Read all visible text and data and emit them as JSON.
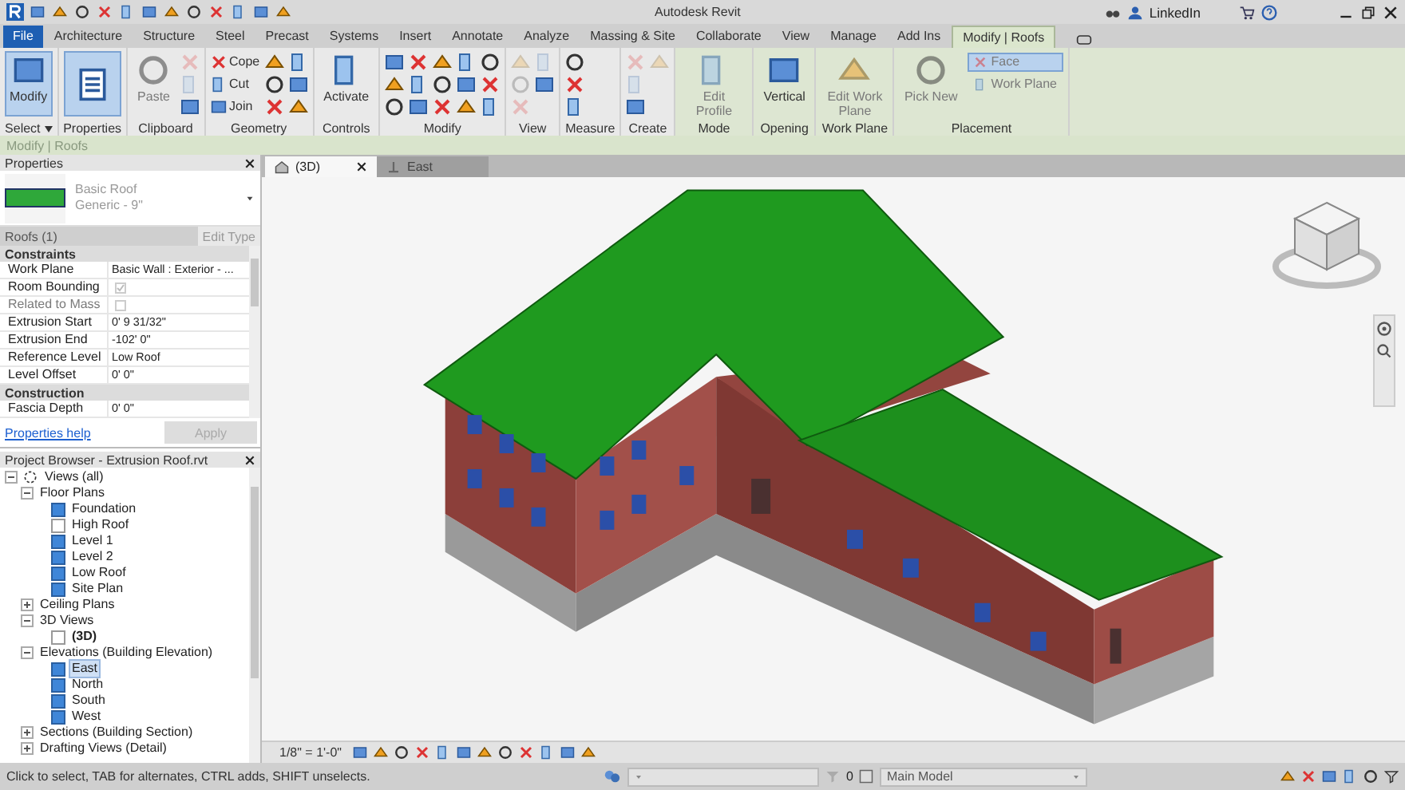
{
  "title_bar": {
    "title": "Autodesk Revit",
    "user": "LinkedIn"
  },
  "ribbon_tabs": [
    {
      "label": "File",
      "kind": "file",
      "selected": false
    },
    {
      "label": "Architecture",
      "kind": "tab",
      "selected": false
    },
    {
      "label": "Structure",
      "kind": "tab",
      "selected": false
    },
    {
      "label": "Steel",
      "kind": "tab",
      "selected": false
    },
    {
      "label": "Precast",
      "kind": "tab",
      "selected": false
    },
    {
      "label": "Systems",
      "kind": "tab",
      "selected": false
    },
    {
      "label": "Insert",
      "kind": "tab",
      "selected": false
    },
    {
      "label": "Annotate",
      "kind": "tab",
      "selected": false
    },
    {
      "label": "Analyze",
      "kind": "tab",
      "selected": false
    },
    {
      "label": "Massing & Site",
      "kind": "tab",
      "selected": false
    },
    {
      "label": "Collaborate",
      "kind": "tab",
      "selected": false
    },
    {
      "label": "View",
      "kind": "tab",
      "selected": false
    },
    {
      "label": "Manage",
      "kind": "tab",
      "selected": false
    },
    {
      "label": "Add Ins",
      "kind": "tab",
      "selected": false
    },
    {
      "label": "Modify | Roofs",
      "kind": "contextual",
      "selected": true
    }
  ],
  "ribbon_panels": [
    {
      "label": "Select",
      "dropdown": true,
      "contextual": false,
      "tools": [
        {
          "kind": "large",
          "label": "Modify",
          "selected": true,
          "disabled": false
        }
      ]
    },
    {
      "label": "Properties",
      "dropdown": false,
      "contextual": false,
      "tools": [
        {
          "kind": "large-icon",
          "selected": true,
          "disabled": false
        }
      ]
    },
    {
      "label": "Clipboard",
      "dropdown": false,
      "contextual": false,
      "tools": [
        {
          "kind": "large",
          "label": "Paste",
          "selected": false,
          "disabled": true
        },
        {
          "kind": "icon",
          "selected": false,
          "disabled": true
        },
        {
          "kind": "icon",
          "selected": false,
          "disabled": true
        },
        {
          "kind": "icon",
          "selected": false,
          "disabled": false
        }
      ]
    },
    {
      "label": "Geometry",
      "dropdown": false,
      "contextual": false,
      "tools": [
        {
          "kind": "small",
          "label": "Cope",
          "selected": false,
          "disabled": false
        },
        {
          "kind": "small",
          "label": "Cut",
          "selected": false,
          "disabled": false
        },
        {
          "kind": "small",
          "label": "Join",
          "selected": false,
          "disabled": false
        },
        {
          "kind": "icon",
          "selected": false,
          "disabled": false
        },
        {
          "kind": "icon",
          "selected": false,
          "disabled": false
        },
        {
          "kind": "icon",
          "selected": false,
          "disabled": false
        },
        {
          "kind": "icon",
          "selected": false,
          "disabled": false
        },
        {
          "kind": "icon",
          "selected": false,
          "disabled": false
        },
        {
          "kind": "icon",
          "selected": false,
          "disabled": false
        }
      ]
    },
    {
      "label": "Controls",
      "dropdown": false,
      "contextual": false,
      "tools": [
        {
          "kind": "large",
          "label": "Activate",
          "selected": false,
          "disabled": false
        }
      ]
    },
    {
      "label": "Modify",
      "dropdown": false,
      "contextual": false,
      "tools": [
        {
          "kind": "icon",
          "selected": false,
          "disabled": false
        },
        {
          "kind": "icon",
          "selected": false,
          "disabled": false
        },
        {
          "kind": "icon",
          "selected": false,
          "disabled": false
        },
        {
          "kind": "icon",
          "selected": false,
          "disabled": false
        },
        {
          "kind": "icon",
          "selected": false,
          "disabled": false
        },
        {
          "kind": "icon",
          "selected": false,
          "disabled": false
        },
        {
          "kind": "icon",
          "selected": false,
          "disabled": false
        },
        {
          "kind": "icon",
          "selected": false,
          "disabled": false
        },
        {
          "kind": "icon",
          "selected": false,
          "disabled": false
        },
        {
          "kind": "icon",
          "selected": false,
          "disabled": false
        },
        {
          "kind": "icon",
          "selected": false,
          "disabled": false
        },
        {
          "kind": "icon",
          "selected": false,
          "disabled": false
        },
        {
          "kind": "icon",
          "selected": false,
          "disabled": false
        },
        {
          "kind": "icon",
          "selected": false,
          "disabled": false
        },
        {
          "kind": "icon",
          "selected": false,
          "disabled": false
        }
      ]
    },
    {
      "label": "View",
      "dropdown": false,
      "contextual": false,
      "tools": [
        {
          "kind": "icon",
          "selected": false,
          "disabled": true
        },
        {
          "kind": "icon",
          "selected": false,
          "disabled": true
        },
        {
          "kind": "icon",
          "selected": false,
          "disabled": true
        },
        {
          "kind": "icon",
          "selected": false,
          "disabled": true
        },
        {
          "kind": "icon",
          "selected": false,
          "disabled": false
        }
      ]
    },
    {
      "label": "Measure",
      "dropdown": false,
      "contextual": false,
      "tools": [
        {
          "kind": "icon",
          "selected": false,
          "disabled": false
        },
        {
          "kind": "icon",
          "selected": false,
          "disabled": false
        },
        {
          "kind": "icon",
          "selected": false,
          "disabled": false
        }
      ]
    },
    {
      "label": "Create",
      "dropdown": false,
      "contextual": false,
      "tools": [
        {
          "kind": "icon",
          "selected": false,
          "disabled": true
        },
        {
          "kind": "icon",
          "selected": false,
          "disabled": true
        },
        {
          "kind": "icon",
          "selected": false,
          "disabled": false
        },
        {
          "kind": "icon",
          "selected": false,
          "disabled": true
        }
      ]
    },
    {
      "label": "Mode",
      "dropdown": false,
      "contextual": true,
      "tools": [
        {
          "kind": "large",
          "label": "Edit Profile",
          "selected": false,
          "disabled": true
        }
      ]
    },
    {
      "label": "Opening",
      "dropdown": false,
      "contextual": true,
      "tools": [
        {
          "kind": "large",
          "label": "Vertical",
          "selected": false,
          "disabled": false
        }
      ]
    },
    {
      "label": "Work Plane",
      "dropdown": false,
      "contextual": true,
      "tools": [
        {
          "kind": "large",
          "label": "Edit Work Plane",
          "selected": false,
          "disabled": true
        }
      ]
    },
    {
      "label": "Placement",
      "dropdown": false,
      "contextual": true,
      "tools": [
        {
          "kind": "large",
          "label": "Pick New",
          "selected": false,
          "disabled": true
        },
        {
          "kind": "toggle",
          "label": "Face",
          "selected": true,
          "disabled": true
        },
        {
          "kind": "toggle",
          "label": "Work Plane",
          "selected": false,
          "disabled": true
        }
      ]
    }
  ],
  "context_bar": {
    "label": "Modify | Roofs"
  },
  "properties": {
    "title": "Properties",
    "type_name": "Basic Roof",
    "type_detail": "Generic - 9\"",
    "selection": "Roofs (1)",
    "edit_type": "Edit Type",
    "groups": [
      {
        "label": "Constraints",
        "rows": [
          {
            "label": "Work Plane",
            "kind": "text",
            "value": "Basic Wall : Exterior - ...",
            "disabled": false
          },
          {
            "label": "Room Bounding",
            "kind": "check",
            "checked": true,
            "disabled": true
          },
          {
            "label": "Related to Mass",
            "kind": "check",
            "checked": false,
            "disabled": true
          },
          {
            "label": "Extrusion Start",
            "kind": "text",
            "value": "0'  9 31/32\"",
            "disabled": false
          },
          {
            "label": "Extrusion End",
            "kind": "text",
            "value": "-102'  0\"",
            "disabled": false
          },
          {
            "label": "Reference Level",
            "kind": "text",
            "value": "Low Roof",
            "disabled": false
          },
          {
            "label": "Level Offset",
            "kind": "text",
            "value": "0'  0\"",
            "disabled": false
          }
        ]
      },
      {
        "label": "Construction",
        "rows": [
          {
            "label": "Fascia Depth",
            "kind": "text",
            "value": "0'  0\"",
            "disabled": false
          }
        ]
      }
    ],
    "help_link": "Properties help",
    "apply": "Apply"
  },
  "project_browser": {
    "title": "Project Browser - Extrusion Roof.rvt",
    "tree": [
      {
        "label": "Views (all)",
        "kind": "root",
        "expanded": true,
        "selected": false,
        "children": [
          {
            "label": "Floor Plans",
            "kind": "group",
            "expanded": true,
            "selected": false,
            "children": [
              {
                "label": "Foundation",
                "kind": "view",
                "active": false,
                "selected": false
              },
              {
                "label": "High Roof",
                "kind": "blank",
                "active": false,
                "selected": false
              },
              {
                "label": "Level 1",
                "kind": "view",
                "active": false,
                "selected": false
              },
              {
                "label": "Level 2",
                "kind": "view",
                "active": false,
                "selected": false
              },
              {
                "label": "Low Roof",
                "kind": "view",
                "active": false,
                "selected": false
              },
              {
                "label": "Site Plan",
                "kind": "view",
                "active": false,
                "selected": false
              }
            ]
          },
          {
            "label": "Ceiling Plans",
            "kind": "group",
            "expanded": false,
            "selected": false
          },
          {
            "label": "3D Views",
            "kind": "group",
            "expanded": true,
            "selected": false,
            "children": [
              {
                "label": "(3D)",
                "kind": "blank",
                "active": true,
                "selected": false
              }
            ]
          },
          {
            "label": "Elevations (Building Elevation)",
            "kind": "group",
            "expanded": true,
            "selected": false,
            "children": [
              {
                "label": "East",
                "kind": "view",
                "active": false,
                "selected": true
              },
              {
                "label": "North",
                "kind": "view",
                "active": false,
                "selected": false
              },
              {
                "label": "South",
                "kind": "view",
                "active": false,
                "selected": false
              },
              {
                "label": "West",
                "kind": "view",
                "active": false,
                "selected": false
              }
            ]
          },
          {
            "label": "Sections (Building Section)",
            "kind": "group",
            "expanded": false,
            "selected": false
          },
          {
            "label": "Drafting Views (Detail)",
            "kind": "group",
            "expanded": false,
            "selected": false
          }
        ]
      }
    ]
  },
  "view_tabs": [
    {
      "label": "(3D)",
      "kind": "perspective",
      "selected": true
    },
    {
      "label": "East",
      "kind": "elevation",
      "selected": false
    }
  ],
  "view_bar": {
    "scale": "1/8\" = 1'-0\""
  },
  "status_bar": {
    "message": "Click to select, TAB for alternates, CTRL adds, SHIFT unselects.",
    "count": "0",
    "model": "Main Model"
  }
}
